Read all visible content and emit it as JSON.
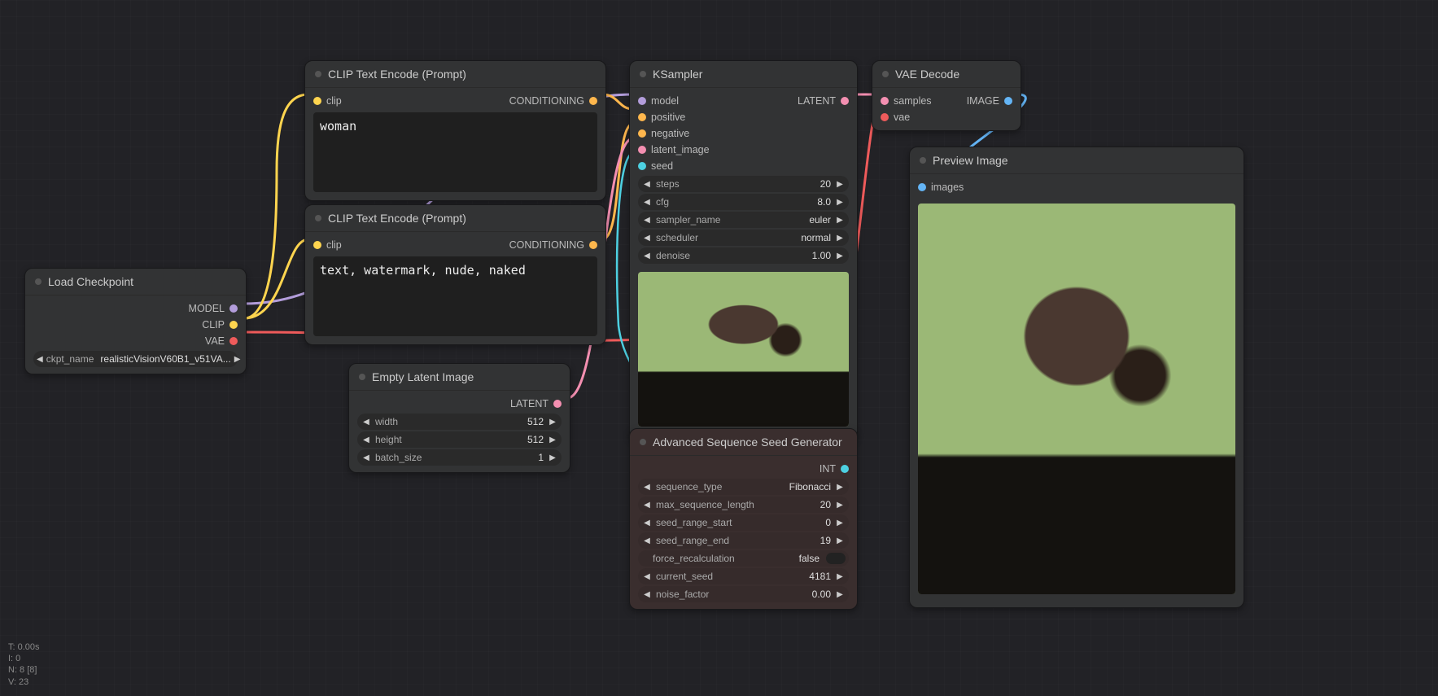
{
  "stats": {
    "t": "T: 0.00s",
    "i": "I: 0",
    "n": "N: 8 [8]",
    "v": "V: 23"
  },
  "load_checkpoint": {
    "title": "Load Checkpoint",
    "out_model": "MODEL",
    "out_clip": "CLIP",
    "out_vae": "VAE",
    "ckpt_label": "ckpt_name",
    "ckpt_value": "realisticVisionV60B1_v51VA..."
  },
  "clip_pos": {
    "title": "CLIP Text Encode (Prompt)",
    "in_clip": "clip",
    "out": "CONDITIONING",
    "text": "woman"
  },
  "clip_neg": {
    "title": "CLIP Text Encode (Prompt)",
    "in_clip": "clip",
    "out": "CONDITIONING",
    "text": "text, watermark, nude, naked"
  },
  "empty_latent": {
    "title": "Empty Latent Image",
    "out": "LATENT",
    "width_label": "width",
    "width_value": "512",
    "height_label": "height",
    "height_value": "512",
    "batch_label": "batch_size",
    "batch_value": "1"
  },
  "ksampler": {
    "title": "KSampler",
    "in_model": "model",
    "in_positive": "positive",
    "in_negative": "negative",
    "in_latent": "latent_image",
    "in_seed": "seed",
    "out": "LATENT",
    "steps_label": "steps",
    "steps_value": "20",
    "cfg_label": "cfg",
    "cfg_value": "8.0",
    "sampler_label": "sampler_name",
    "sampler_value": "euler",
    "sched_label": "scheduler",
    "sched_value": "normal",
    "denoise_label": "denoise",
    "denoise_value": "1.00"
  },
  "vae_decode": {
    "title": "VAE Decode",
    "in_samples": "samples",
    "in_vae": "vae",
    "out": "IMAGE"
  },
  "seed_gen": {
    "title": "Advanced Sequence Seed Generator",
    "out": "INT",
    "seq_label": "sequence_type",
    "seq_value": "Fibonacci",
    "max_label": "max_sequence_length",
    "max_value": "20",
    "start_label": "seed_range_start",
    "start_value": "0",
    "end_label": "seed_range_end",
    "end_value": "19",
    "force_label": "force_recalculation",
    "force_value": "false",
    "cur_label": "current_seed",
    "cur_value": "4181",
    "noise_label": "noise_factor",
    "noise_value": "0.00"
  },
  "preview": {
    "title": "Preview Image",
    "in_images": "images"
  }
}
